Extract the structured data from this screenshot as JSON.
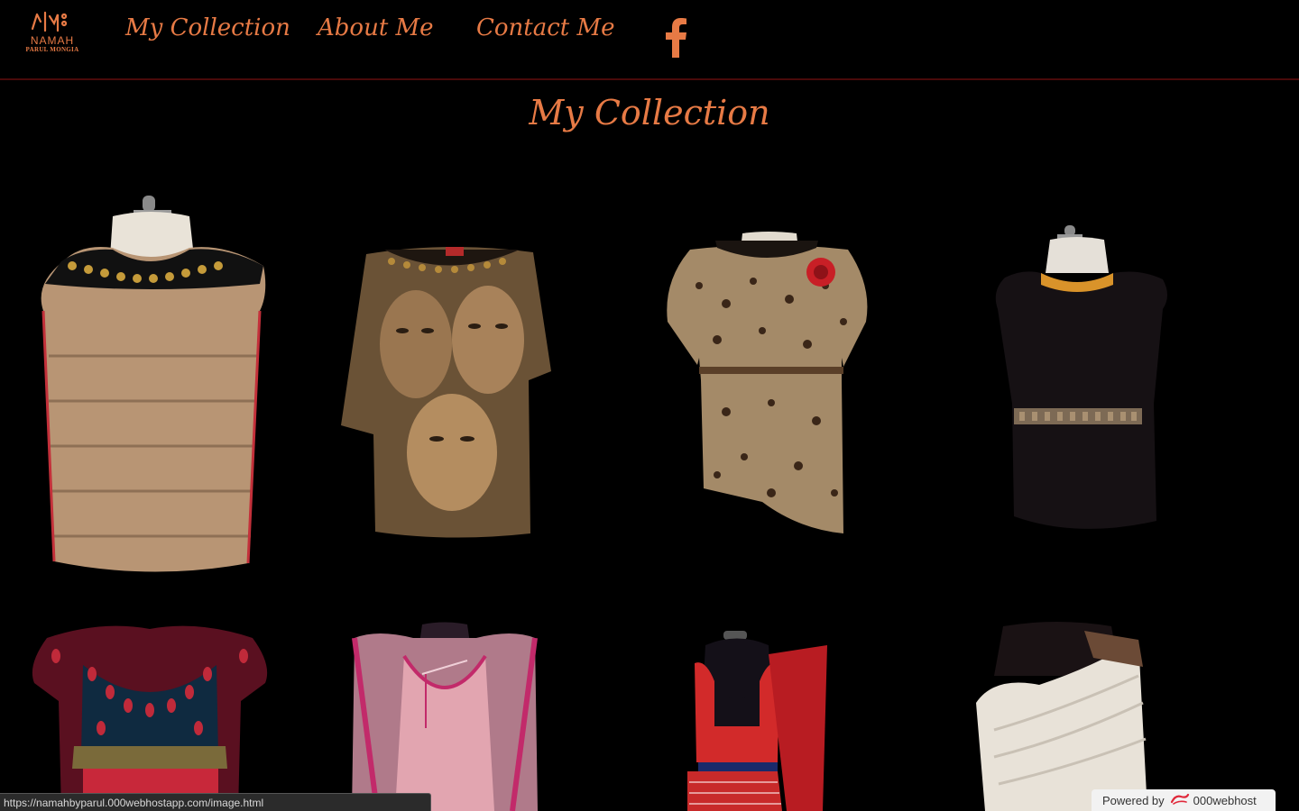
{
  "header": {
    "logo": {
      "name": "NAMAH",
      "subtitle": "PARUL MONGIA",
      "icon": "namah-logo"
    },
    "nav": [
      {
        "label": "My Collection"
      },
      {
        "label": "About Me"
      },
      {
        "label": "Contact Me"
      }
    ],
    "social_icon": "facebook-icon"
  },
  "main": {
    "title": "My Collection",
    "gallery": [
      {
        "icon": "mannequin-beige-mesh-top"
      },
      {
        "icon": "printed-faces-tee"
      },
      {
        "icon": "leopard-print-belted-top"
      },
      {
        "icon": "black-belted-dress"
      },
      {
        "icon": "embroidered-red-blouse"
      },
      {
        "icon": "pink-embellished-suit"
      },
      {
        "icon": "red-backless-blouse"
      },
      {
        "icon": "white-draped-gown"
      }
    ]
  },
  "status_url": "https://namahbyparul.000webhostapp.com/image.html",
  "powered_by": {
    "prefix": "Powered by",
    "brand": "000webhost"
  },
  "colors": {
    "accent": "#e77a45",
    "background": "#000000",
    "divider": "#4a0a0a"
  }
}
